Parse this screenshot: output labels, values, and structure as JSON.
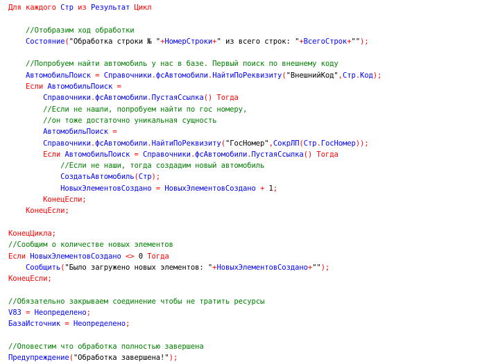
{
  "editor": {
    "colors": {
      "keyword": "#ff0000",
      "identifier": "#0000ff",
      "operator": "#ff0000",
      "string": "#000000",
      "comment": "#008000",
      "background": "#ffffff"
    },
    "lines": [
      [
        {
          "k": "kw",
          "t": "Для каждого "
        },
        {
          "k": "id",
          "t": "Стр"
        },
        {
          "k": "kw",
          "t": " из "
        },
        {
          "k": "id",
          "t": "Результат"
        },
        {
          "k": "kw",
          "t": " Цикл"
        }
      ],
      [],
      [
        {
          "k": "pl",
          "t": "    "
        },
        {
          "k": "cm",
          "t": "//Отобразим ход обработки"
        }
      ],
      [
        {
          "k": "pl",
          "t": "    "
        },
        {
          "k": "id",
          "t": "Состояние"
        },
        {
          "k": "op",
          "t": "("
        },
        {
          "k": "str",
          "t": "\"Обработка строки № \""
        },
        {
          "k": "op",
          "t": "+"
        },
        {
          "k": "id",
          "t": "НомерСтроки"
        },
        {
          "k": "op",
          "t": "+"
        },
        {
          "k": "str",
          "t": "\" из всего строк: \""
        },
        {
          "k": "op",
          "t": "+"
        },
        {
          "k": "id",
          "t": "ВсегоСтрок"
        },
        {
          "k": "op",
          "t": "+"
        },
        {
          "k": "str",
          "t": "\"\""
        },
        {
          "k": "op",
          "t": ");"
        }
      ],
      [],
      [
        {
          "k": "pl",
          "t": "    "
        },
        {
          "k": "cm",
          "t": "//Попробуем найти автомобиль у нас в базе. Первый поиск по внешнему коду"
        }
      ],
      [
        {
          "k": "pl",
          "t": "    "
        },
        {
          "k": "id",
          "t": "АвтомобильПоиск"
        },
        {
          "k": "op",
          "t": " = "
        },
        {
          "k": "id",
          "t": "Справочники"
        },
        {
          "k": "op",
          "t": "."
        },
        {
          "k": "id",
          "t": "фсАвтомобили"
        },
        {
          "k": "op",
          "t": "."
        },
        {
          "k": "id",
          "t": "НайтиПоРеквизиту"
        },
        {
          "k": "op",
          "t": "("
        },
        {
          "k": "str",
          "t": "\"ВнешнийКод\""
        },
        {
          "k": "op",
          "t": ","
        },
        {
          "k": "id",
          "t": "Стр"
        },
        {
          "k": "op",
          "t": "."
        },
        {
          "k": "id",
          "t": "Код"
        },
        {
          "k": "op",
          "t": ");"
        }
      ],
      [
        {
          "k": "pl",
          "t": "    "
        },
        {
          "k": "kw",
          "t": "Если "
        },
        {
          "k": "id",
          "t": "АвтомобильПоиск"
        },
        {
          "k": "op",
          "t": " ="
        }
      ],
      [
        {
          "k": "pl",
          "t": "        "
        },
        {
          "k": "id",
          "t": "Справочники"
        },
        {
          "k": "op",
          "t": "."
        },
        {
          "k": "id",
          "t": "фсАвтомобили"
        },
        {
          "k": "op",
          "t": "."
        },
        {
          "k": "id",
          "t": "ПустаяСсылка"
        },
        {
          "k": "op",
          "t": "()"
        },
        {
          "k": "kw",
          "t": " Тогда"
        }
      ],
      [
        {
          "k": "pl",
          "t": "        "
        },
        {
          "k": "cm",
          "t": "//Если не нашли, попробуем найти по гос номеру,"
        }
      ],
      [
        {
          "k": "pl",
          "t": "        "
        },
        {
          "k": "cm",
          "t": "//он тоже достаточно уникальная сущность"
        }
      ],
      [
        {
          "k": "pl",
          "t": "        "
        },
        {
          "k": "id",
          "t": "АвтомобильПоиск"
        },
        {
          "k": "op",
          "t": " ="
        }
      ],
      [
        {
          "k": "pl",
          "t": "        "
        },
        {
          "k": "id",
          "t": "Справочники"
        },
        {
          "k": "op",
          "t": "."
        },
        {
          "k": "id",
          "t": "фсАвтомобили"
        },
        {
          "k": "op",
          "t": "."
        },
        {
          "k": "id",
          "t": "НайтиПоРеквизиту"
        },
        {
          "k": "op",
          "t": "("
        },
        {
          "k": "str",
          "t": "\"ГосНомер\""
        },
        {
          "k": "op",
          "t": ","
        },
        {
          "k": "id",
          "t": "СокрЛП"
        },
        {
          "k": "op",
          "t": "("
        },
        {
          "k": "id",
          "t": "Стр"
        },
        {
          "k": "op",
          "t": "."
        },
        {
          "k": "id",
          "t": "ГосНомер"
        },
        {
          "k": "op",
          "t": "));"
        }
      ],
      [
        {
          "k": "pl",
          "t": "        "
        },
        {
          "k": "kw",
          "t": "Если "
        },
        {
          "k": "id",
          "t": "АвтомобильПоиск"
        },
        {
          "k": "op",
          "t": " = "
        },
        {
          "k": "id",
          "t": "Справочники"
        },
        {
          "k": "op",
          "t": "."
        },
        {
          "k": "id",
          "t": "фсАвтомобили"
        },
        {
          "k": "op",
          "t": "."
        },
        {
          "k": "id",
          "t": "ПустаяСсылка"
        },
        {
          "k": "op",
          "t": "()"
        },
        {
          "k": "kw",
          "t": " Тогда"
        }
      ],
      [
        {
          "k": "pl",
          "t": "            "
        },
        {
          "k": "cm",
          "t": "//Если не наши, тогда создадим новый автомобиль"
        }
      ],
      [
        {
          "k": "pl",
          "t": "            "
        },
        {
          "k": "id",
          "t": "СоздатьАвтомобиль"
        },
        {
          "k": "op",
          "t": "("
        },
        {
          "k": "id",
          "t": "Стр"
        },
        {
          "k": "op",
          "t": ");"
        }
      ],
      [
        {
          "k": "pl",
          "t": "            "
        },
        {
          "k": "id",
          "t": "НовыхЭлементовСоздано"
        },
        {
          "k": "op",
          "t": " = "
        },
        {
          "k": "id",
          "t": "НовыхЭлементовСоздано"
        },
        {
          "k": "op",
          "t": " + "
        },
        {
          "k": "num",
          "t": "1"
        },
        {
          "k": "op",
          "t": ";"
        }
      ],
      [
        {
          "k": "pl",
          "t": "        "
        },
        {
          "k": "kw",
          "t": "КонецЕсли"
        },
        {
          "k": "op",
          "t": ";"
        }
      ],
      [
        {
          "k": "pl",
          "t": "    "
        },
        {
          "k": "kw",
          "t": "КонецЕсли"
        },
        {
          "k": "op",
          "t": ";"
        }
      ],
      [],
      [
        {
          "k": "kw",
          "t": "КонецЦикла"
        },
        {
          "k": "op",
          "t": ";"
        }
      ],
      [
        {
          "k": "cm",
          "t": "//Сообщим о количестве новых элементов"
        }
      ],
      [
        {
          "k": "kw",
          "t": "Если "
        },
        {
          "k": "id",
          "t": "НовыхЭлементовСоздано"
        },
        {
          "k": "op",
          "t": " <> "
        },
        {
          "k": "num",
          "t": "0"
        },
        {
          "k": "kw",
          "t": " Тогда"
        }
      ],
      [
        {
          "k": "pl",
          "t": "    "
        },
        {
          "k": "id",
          "t": "Сообщить"
        },
        {
          "k": "op",
          "t": "("
        },
        {
          "k": "str",
          "t": "\"Было загружено новых элементов: \""
        },
        {
          "k": "op",
          "t": "+"
        },
        {
          "k": "id",
          "t": "НовыхЭлементовСоздано"
        },
        {
          "k": "op",
          "t": "+"
        },
        {
          "k": "str",
          "t": "\"\""
        },
        {
          "k": "op",
          "t": ");"
        }
      ],
      [
        {
          "k": "kw",
          "t": "КонецЕсли"
        },
        {
          "k": "op",
          "t": ";"
        }
      ],
      [],
      [
        {
          "k": "cm",
          "t": "//Обязательно закрываем соединение чтобы не тратить ресурсы"
        }
      ],
      [
        {
          "k": "id",
          "t": "V83"
        },
        {
          "k": "op",
          "t": " = "
        },
        {
          "k": "id",
          "t": "Неопределено"
        },
        {
          "k": "op",
          "t": ";"
        }
      ],
      [
        {
          "k": "id",
          "t": "БазаИсточник"
        },
        {
          "k": "op",
          "t": " = "
        },
        {
          "k": "id",
          "t": "Неопределено"
        },
        {
          "k": "op",
          "t": ";"
        }
      ],
      [],
      [
        {
          "k": "cm",
          "t": "//Оповестим что обработка полностью завершена"
        }
      ],
      [
        {
          "k": "id",
          "t": "Предупреждение"
        },
        {
          "k": "op",
          "t": "("
        },
        {
          "k": "str",
          "t": "\"Обработка завершена!\""
        },
        {
          "k": "op",
          "t": ");"
        }
      ]
    ]
  }
}
